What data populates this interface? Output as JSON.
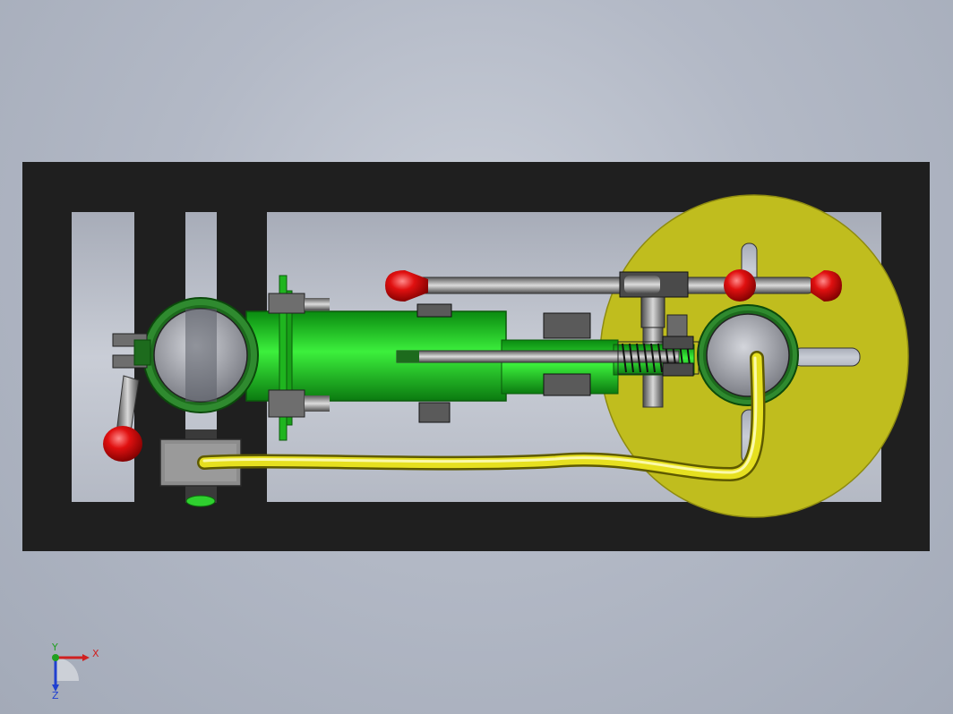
{
  "viewport": {
    "background_top": "#c9ced8",
    "background_bottom": "#a3aab8"
  },
  "model": {
    "frame_color": "#1f1f1f",
    "body_green": "#2fd02f",
    "disc_yellow": "#c0bd1e",
    "knob_red": "#e01010",
    "tube_yellow": "#e6e020",
    "steel_gray": "#8a8a8a",
    "parts": [
      "base-frame",
      "cylinder-body",
      "left-ring-clamp",
      "right-ring-clamp",
      "flywheel-disc",
      "handle-lever",
      "piston-rod",
      "spring",
      "feed-tube",
      "valve-block"
    ]
  },
  "triad": {
    "x_label": "X",
    "y_label": "Y",
    "z_label": "Z",
    "x_color": "#d02020",
    "y_color": "#20a020",
    "z_color": "#2040d0"
  }
}
